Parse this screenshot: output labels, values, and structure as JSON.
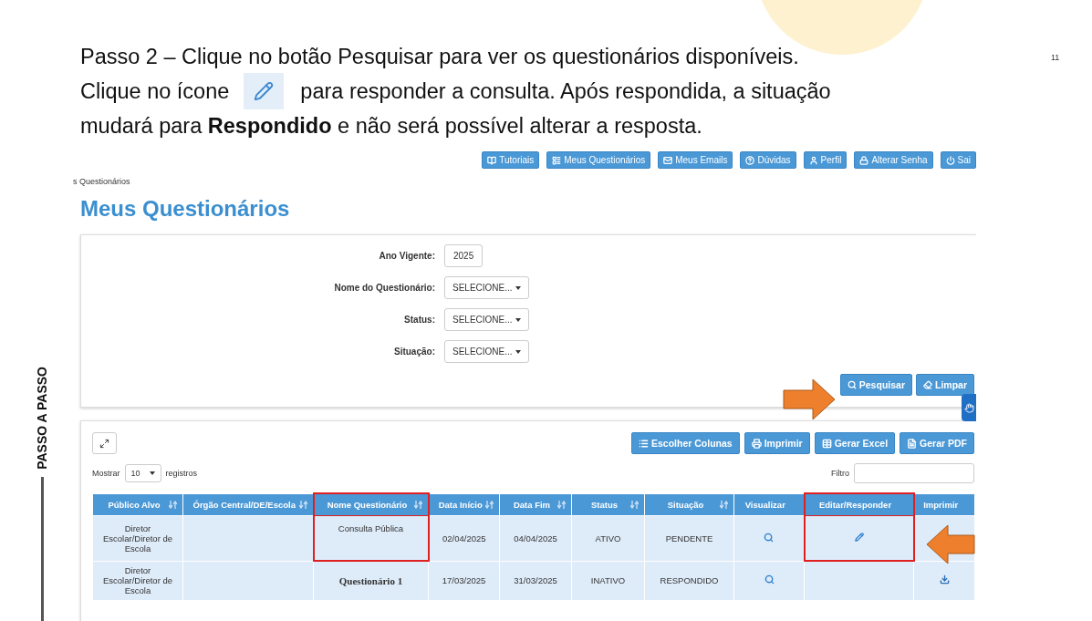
{
  "slide": {
    "title_lines": [
      "Passo 2 – Clique no botão Pesquisar para ver os questionários disponíveis.",
      "Clique no ícone",
      "para responder a consulta. Após respondida, a situação",
      "mudará para **Respondido** e não será possível alterar a resposta."
    ],
    "page_number": "11",
    "side_label": "PASSO A PASSO"
  },
  "nav_buttons": [
    "Tutoriais",
    "Meus Questionários",
    "Meus Emails",
    "Dúvidas",
    "Perfil",
    "Alterar Senha",
    "Sai"
  ],
  "breadcrumb": "s Questionários",
  "heading": "Meus Questionários",
  "filters": [
    {
      "kind": "text",
      "label": "Ano Vigente:",
      "value": "2025"
    },
    {
      "kind": "select",
      "label": "Nome do Questionário:",
      "value": "SELECIONE..."
    },
    {
      "kind": "select",
      "label": "Status:",
      "value": "SELECIONE..."
    },
    {
      "kind": "select",
      "label": "Situação:",
      "value": "SELECIONE..."
    }
  ],
  "filter_buttons": [
    "Pesquisar",
    "Limpar"
  ],
  "table_buttons": [
    "Escolher Colunas",
    "Imprimir",
    "Gerar Excel",
    "Gerar PDF"
  ],
  "length": {
    "before": "Mostrar",
    "value": "10",
    "after": "registros"
  },
  "filter_label": "Filtro",
  "table": {
    "columns": [
      {
        "label": "Público Alvo",
        "sortable": true,
        "highlighted": false
      },
      {
        "label": "Órgão Central/DE/Escola",
        "sortable": true,
        "highlighted": false
      },
      {
        "label": "Nome Questionário",
        "sortable": true,
        "highlighted": true
      },
      {
        "label": "Data Início",
        "sortable": true,
        "highlighted": false
      },
      {
        "label": "Data Fim",
        "sortable": true,
        "highlighted": false
      },
      {
        "label": "Status",
        "sortable": true,
        "highlighted": false
      },
      {
        "label": "Situação",
        "sortable": true,
        "highlighted": false
      },
      {
        "label": "Visualizar",
        "sortable": false,
        "highlighted": false
      },
      {
        "label": "Editar/Responder",
        "sortable": false,
        "highlighted": true
      },
      {
        "label": "Imprimir",
        "sortable": false,
        "highlighted": false
      }
    ],
    "rows": [
      {
        "publico_alvo": "Diretor Escolar/Diretor de Escola",
        "nome": "Consulta Pública",
        "nome_serif": false,
        "data_inicio": "02/04/2025",
        "data_fim": "04/04/2025",
        "status": "ATIVO",
        "situacao": "PENDENTE",
        "can_view": true,
        "can_edit": true,
        "can_print": false
      },
      {
        "publico_alvo": "Diretor Escolar/Diretor de Escola",
        "nome": "Questionário 1",
        "nome_serif": true,
        "data_inicio": "17/03/2025",
        "data_fim": "31/03/2025",
        "status": "INATIVO",
        "situacao": "RESPONDIDO",
        "can_view": true,
        "can_edit": false,
        "can_print": true
      }
    ]
  }
}
